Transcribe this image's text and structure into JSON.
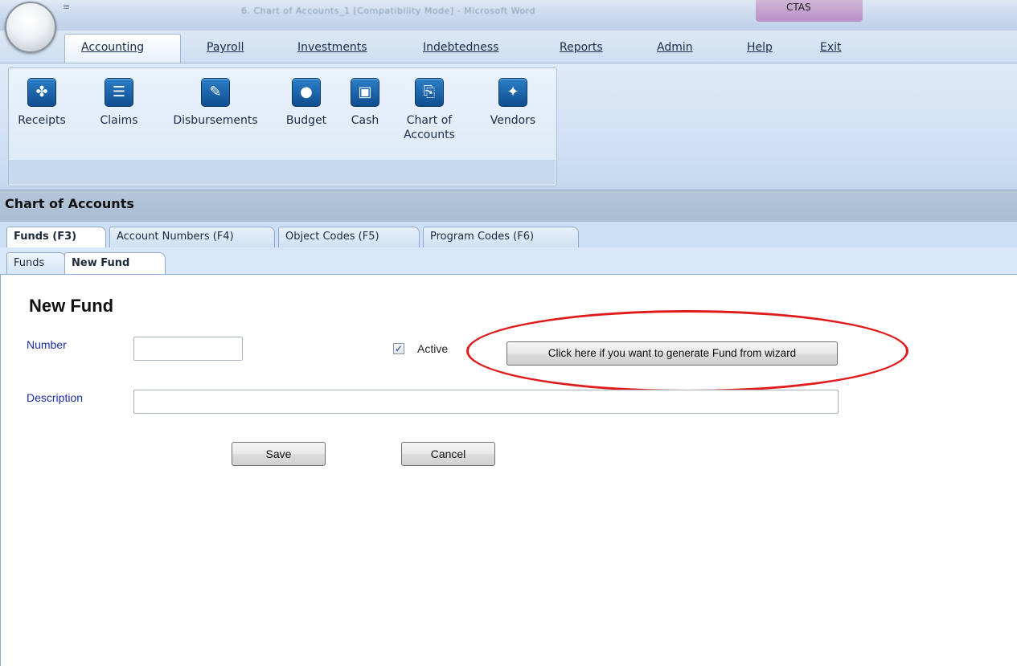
{
  "window": {
    "app_label": "CTAS",
    "title_blurred": "6. Chart of Accounts_1 [Compatibility Mode] - Microsoft Word",
    "qat_glyph": "≡"
  },
  "ribbon": {
    "tabs": [
      {
        "label": "Accounting",
        "underline_index": 0,
        "selected": true
      },
      {
        "label": "Payroll"
      },
      {
        "label": "Investments"
      },
      {
        "label": "Indebtedness"
      },
      {
        "label": "Reports"
      },
      {
        "label": "Admin"
      },
      {
        "label": "Help"
      },
      {
        "label": "Exit"
      }
    ],
    "buttons": [
      {
        "label": "Receipts",
        "icon": "receipts-icon",
        "glyph": "✤"
      },
      {
        "label": "Claims",
        "icon": "claims-icon",
        "glyph": "☰"
      },
      {
        "label": "Disbursements",
        "icon": "disbursements-icon",
        "glyph": "✎"
      },
      {
        "label": "Budget",
        "icon": "piggy-bank-icon",
        "glyph": "●"
      },
      {
        "label": "Cash",
        "icon": "cash-icon",
        "glyph": "▣"
      },
      {
        "label": "Chart of Accounts",
        "line1": "Chart of",
        "line2": "Accounts",
        "icon": "chart-of-accounts-icon",
        "glyph": "⎘"
      },
      {
        "label": "Vendors",
        "icon": "handshake-icon",
        "glyph": "✦"
      }
    ]
  },
  "section": {
    "title": "Chart of Accounts"
  },
  "tabs_primary": [
    {
      "label": "Funds (F3)",
      "selected": true
    },
    {
      "label": "Account Numbers (F4)"
    },
    {
      "label": "Object Codes (F5)"
    },
    {
      "label": "Program Codes (F6)"
    }
  ],
  "tabs_secondary": [
    {
      "label": "Funds"
    },
    {
      "label": "New Fund",
      "selected": true
    }
  ],
  "form": {
    "title": "New Fund",
    "number_label": "Number",
    "number_value": "",
    "active_label": "Active",
    "active_checked": true,
    "check_glyph": "✓",
    "wizard_button": "Click here if you want to generate Fund from wizard",
    "description_label": "Description",
    "description_value": "",
    "save_label": "Save",
    "cancel_label": "Cancel"
  },
  "colors": {
    "annotation": "#e01a1a",
    "label_blue": "#1c2fa8",
    "ctas_tab": "#b98fc6"
  }
}
